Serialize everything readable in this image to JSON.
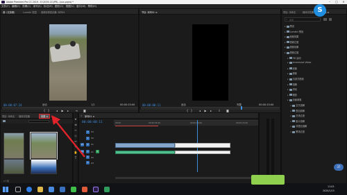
{
  "window": {
    "title": "Adobe Premiere Pro CC 2019 - E:\\2019-11\\\\PR\\...\\xxx.prproj *"
  },
  "menu": [
    "文件(F)",
    "编辑(E)",
    "剪辑(C)",
    "序列(S)",
    "标记(M)",
    "图形(G)",
    "视图(V)",
    "窗口(W)",
    "帮助(H)"
  ],
  "source_monitor": {
    "tabs": [
      "源: (无剪辑)",
      "Lumetri 范围",
      "音频剪辑混合器: 序列01"
    ],
    "timecode_in": "00:00:07:24",
    "timecode_out": "00:00:15:00",
    "zoom": "适合",
    "fraction": "1/2"
  },
  "program_monitor": {
    "tab": "节目: 序列01 ≡",
    "timecode_in": "00:00:00:11",
    "timecode_out": "00:00:15:00",
    "zoom": "适合",
    "fraction": "完整"
  },
  "project_panel": {
    "tabs": [
      "项目: 未命名",
      "媒体浏览器",
      "效果 ≡"
    ],
    "search_placeholder": "搜索",
    "items": [
      {
        "label": "预设",
        "depth": 0
      },
      {
        "label": "Lumetri 预设",
        "depth": 0
      },
      {
        "label": "音频效果",
        "depth": 0
      },
      {
        "label": "音频过渡",
        "depth": 0
      },
      {
        "label": "视频效果",
        "depth": 0
      },
      {
        "label": "视频过渡",
        "depth": 0
      },
      {
        "label": "3D 运动",
        "depth": 1
      },
      {
        "label": "Immersive Video",
        "depth": 1
      },
      {
        "label": "划像",
        "depth": 1
      },
      {
        "label": "擦除",
        "depth": 1
      },
      {
        "label": "沉浸式视频",
        "depth": 1
      },
      {
        "label": "溶解",
        "depth": 1
      },
      {
        "label": "滑动",
        "depth": 1
      },
      {
        "label": "缩放",
        "depth": 1
      },
      {
        "label": "页面剥落",
        "depth": 1
      },
      {
        "label": "交叉溶解",
        "depth": 2
      },
      {
        "label": "叠加溶解",
        "depth": 2
      },
      {
        "label": "白场过渡",
        "depth": 2
      },
      {
        "label": "胶片溶解",
        "depth": 2
      },
      {
        "label": "非叠加溶解",
        "depth": 2
      },
      {
        "label": "黑场过渡",
        "depth": 2
      }
    ]
  },
  "media_panel": {
    "tabs": [
      "项目: 未命名",
      "媒体浏览器",
      "效果"
    ],
    "highlight_tab": "效果 ≡",
    "footer": "2个项"
  },
  "timeline": {
    "tab": "序列01 ≡",
    "timecode": "00:00:00:11",
    "ruler_labels": [
      "00:00",
      "00:00:05:00",
      "00:00:10:00",
      "00:00:15:00"
    ],
    "tracks": [
      "V3",
      "V2",
      "V1",
      "A1",
      "A2",
      "A3"
    ]
  },
  "taskbar": {
    "time": "11:03",
    "date": "2020/1/15",
    "badge": "37"
  },
  "colors": {
    "accent": "#3d8fe0",
    "annotation_arrow": "#e0232b",
    "video_clip": "#85a6c9",
    "audio_clip": "#4fbf8f",
    "logo": "#1f8de0"
  }
}
